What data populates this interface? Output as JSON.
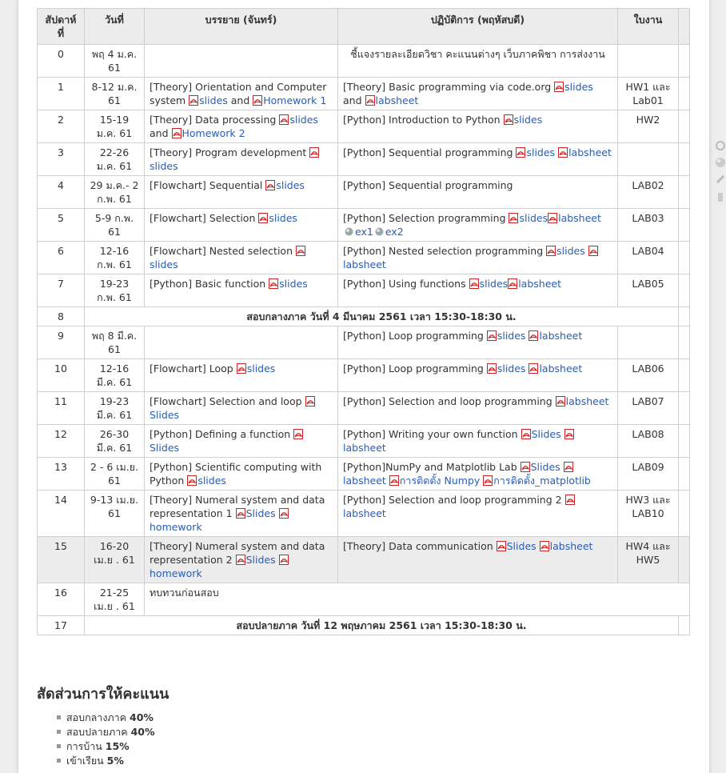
{
  "table": {
    "headers": [
      "สัปดาห์ที่",
      "วันที่",
      "บรรยาย (จันทร์)",
      "ปฏิบัติการ (พฤหัสบดี)",
      "ใบงาน"
    ],
    "rows": [
      {
        "week": "0",
        "date": "พฤ 4 ม.ค. 61",
        "lecture": [],
        "lab_center": true,
        "lab": [
          {
            "t": "text",
            "v": "ชี้แจงรายละเอียดวิชา คะแนนต่างๆ เว็บภาคพิชา การส่งงาน"
          }
        ],
        "work": ""
      },
      {
        "week": "1",
        "date": "8-12 ม.ค. 61",
        "lecture": [
          {
            "t": "text",
            "v": "[Theory] Orientation and Computer system "
          },
          {
            "t": "pdf",
            "v": "slides"
          },
          {
            "t": "text",
            "v": " and "
          },
          {
            "t": "pdf",
            "v": "Homework 1"
          }
        ],
        "lab": [
          {
            "t": "text",
            "v": "[Theory] Basic programming via code.org "
          },
          {
            "t": "pdf",
            "v": "slides"
          },
          {
            "t": "text",
            "v": " and "
          },
          {
            "t": "pdf",
            "v": "labsheet"
          }
        ],
        "work": "HW1 และ Lab01"
      },
      {
        "week": "2",
        "date": "15-19 ม.ค. 61",
        "lecture": [
          {
            "t": "text",
            "v": "[Theory] Data processing "
          },
          {
            "t": "pdf",
            "v": "slides"
          },
          {
            "t": "text",
            "v": " and "
          },
          {
            "t": "pdf",
            "v": "Homework 2"
          }
        ],
        "lab": [
          {
            "t": "text",
            "v": "[Python] Introduction to Python "
          },
          {
            "t": "pdf",
            "v": "slides"
          }
        ],
        "work": "HW2"
      },
      {
        "week": "3",
        "date": "22-26 ม.ค. 61",
        "lecture": [
          {
            "t": "text",
            "v": "[Theory] Program development "
          },
          {
            "t": "pdf",
            "v": "slides"
          }
        ],
        "lab": [
          {
            "t": "text",
            "v": "[Python] Sequential programming "
          },
          {
            "t": "pdf",
            "v": "slides"
          },
          {
            "t": "text",
            "v": " "
          },
          {
            "t": "pdf",
            "v": "labsheet"
          }
        ],
        "work": ""
      },
      {
        "week": "4",
        "date": "29 ม.ค.- 2 ก.พ. 61",
        "lecture": [
          {
            "t": "text",
            "v": "[Flowchart] Sequential "
          },
          {
            "t": "pdf",
            "v": "slides"
          }
        ],
        "lab": [
          {
            "t": "text",
            "v": "[Python] Sequential programming"
          }
        ],
        "work": "LAB02"
      },
      {
        "week": "5",
        "date": "5-9 ก.พ. 61",
        "lecture": [
          {
            "t": "text",
            "v": "[Flowchart] Selection "
          },
          {
            "t": "pdf",
            "v": "slides"
          }
        ],
        "lab": [
          {
            "t": "text",
            "v": "[Python] Selection programming "
          },
          {
            "t": "pdf",
            "v": "slides"
          },
          {
            "t": "pdf",
            "v": "labsheet"
          },
          {
            "t": "globe",
            "v": "ex1"
          },
          {
            "t": "globe",
            "v": "ex2"
          }
        ],
        "work": "LAB03"
      },
      {
        "week": "6",
        "date": "12-16 ก.พ. 61",
        "lecture": [
          {
            "t": "text",
            "v": "[Flowchart] Nested selection "
          },
          {
            "t": "pdf",
            "v": "slides"
          }
        ],
        "lab": [
          {
            "t": "text",
            "v": "[Python] Nested selection programming "
          },
          {
            "t": "pdf",
            "v": "slides"
          },
          {
            "t": "text",
            "v": " "
          },
          {
            "t": "pdf",
            "v": "labsheet"
          }
        ],
        "work": "LAB04"
      },
      {
        "week": "7",
        "date": "19-23 ก.พ. 61",
        "lecture": [
          {
            "t": "text",
            "v": "[Python] Basic function "
          },
          {
            "t": "pdf",
            "v": "slides"
          }
        ],
        "lab": [
          {
            "t": "text",
            "v": "[Python] Using functions "
          },
          {
            "t": "pdf",
            "v": "slides"
          },
          {
            "t": "pdf",
            "v": "labsheet"
          }
        ],
        "work": "LAB05"
      },
      {
        "week": "8",
        "span": "สอบกลางภาค วันที่ 4 มีนาคม 2561 เวลา 15:30-18:30 น."
      },
      {
        "week": "9",
        "date": "พฤ 8 มี.ค. 61",
        "lecture": [],
        "lab": [
          {
            "t": "text",
            "v": "[Python] Loop programming "
          },
          {
            "t": "pdf",
            "v": "slides"
          },
          {
            "t": "text",
            "v": " "
          },
          {
            "t": "pdf",
            "v": "labsheet"
          }
        ],
        "work": ""
      },
      {
        "week": "10",
        "date": "12-16 มี.ค. 61",
        "lecture": [
          {
            "t": "text",
            "v": "[Flowchart] Loop "
          },
          {
            "t": "pdf",
            "v": "slides"
          }
        ],
        "lab": [
          {
            "t": "text",
            "v": "[Python] Loop programming "
          },
          {
            "t": "pdf",
            "v": "slides"
          },
          {
            "t": "text",
            "v": " "
          },
          {
            "t": "pdf",
            "v": "labsheet"
          }
        ],
        "work": "LAB06"
      },
      {
        "week": "11",
        "date": "19-23 มี.ค. 61",
        "lecture": [
          {
            "t": "text",
            "v": "[Flowchart] Selection and loop "
          },
          {
            "t": "pdf",
            "v": "Slides"
          }
        ],
        "lab": [
          {
            "t": "text",
            "v": "[Python] Selection and loop programming "
          },
          {
            "t": "pdf",
            "v": "labsheet"
          }
        ],
        "work": "LAB07"
      },
      {
        "week": "12",
        "date": "26-30 มี.ค. 61",
        "lecture": [
          {
            "t": "text",
            "v": "[Python] Defining a function "
          },
          {
            "t": "pdf",
            "v": "Slides"
          }
        ],
        "lab": [
          {
            "t": "text",
            "v": "[Python] Writing your own function "
          },
          {
            "t": "pdf",
            "v": "Slides"
          },
          {
            "t": "text",
            "v": " "
          },
          {
            "t": "pdf",
            "v": "labsheet"
          }
        ],
        "work": "LAB08"
      },
      {
        "week": "13",
        "date": "2 - 6 เม.ย. 61",
        "lecture": [
          {
            "t": "text",
            "v": "[Python] Scientific computing with Python "
          },
          {
            "t": "pdf",
            "v": "slides"
          }
        ],
        "lab": [
          {
            "t": "text",
            "v": "[Python]NumPy and Matplotlib Lab "
          },
          {
            "t": "pdf",
            "v": "Slides"
          },
          {
            "t": "text",
            "v": " "
          },
          {
            "t": "pdf",
            "v": "labsheet"
          },
          {
            "t": "text",
            "v": " "
          },
          {
            "t": "pdf",
            "v": "การติดตั้ง Numpy"
          },
          {
            "t": "text",
            "v": " "
          },
          {
            "t": "pdf",
            "v": "การติดตั้ง_matplotlib"
          }
        ],
        "work": "LAB09"
      },
      {
        "week": "14",
        "date": "9-13 เม.ย. 61",
        "lecture": [
          {
            "t": "text",
            "v": "[Theory] Numeral system and data representation 1 "
          },
          {
            "t": "pdf",
            "v": "Slides"
          },
          {
            "t": "text",
            "v": " "
          },
          {
            "t": "pdf",
            "v": "homework"
          }
        ],
        "lab": [
          {
            "t": "text",
            "v": "[Python] Selection and loop programming 2 "
          },
          {
            "t": "pdf",
            "v": "labsheet"
          }
        ],
        "work": "HW3 และ LAB10"
      },
      {
        "week": "15",
        "highlight": true,
        "date": "16-20 เม.ย . 61",
        "lecture": [
          {
            "t": "text",
            "v": "[Theory] Numeral system and data representation 2 "
          },
          {
            "t": "pdf",
            "v": "Slides"
          },
          {
            "t": "text",
            "v": " "
          },
          {
            "t": "pdf",
            "v": "homework"
          }
        ],
        "lab": [
          {
            "t": "text",
            "v": "[Theory] Data communication "
          },
          {
            "t": "pdf",
            "v": "Slides"
          },
          {
            "t": "text",
            "v": " "
          },
          {
            "t": "pdf",
            "v": "labsheet"
          }
        ],
        "work": "HW4 และ HW5"
      },
      {
        "week": "16",
        "date": "21-25 เม.ย . 61",
        "span_wide": "ทบทวนก่อนสอบ"
      },
      {
        "week": "17",
        "span": "สอบปลายภาค วันที่ 12 พฤษภาคม 2561 เวลา 15:30-18:30 น."
      }
    ]
  },
  "score": {
    "title": "สัดส่วนการให้คะแนน",
    "items": [
      {
        "label": "สอบกลางภาค ",
        "value": "40%"
      },
      {
        "label": "สอบปลายภาค ",
        "value": "40%"
      },
      {
        "label": "การบ้าน ",
        "value": "15%"
      },
      {
        "label": "เข้าเรียน ",
        "value": "5%"
      }
    ]
  },
  "colors": {
    "link": "#2a5db0",
    "pdf": "#cc2222",
    "header_bg": "#ececec"
  }
}
